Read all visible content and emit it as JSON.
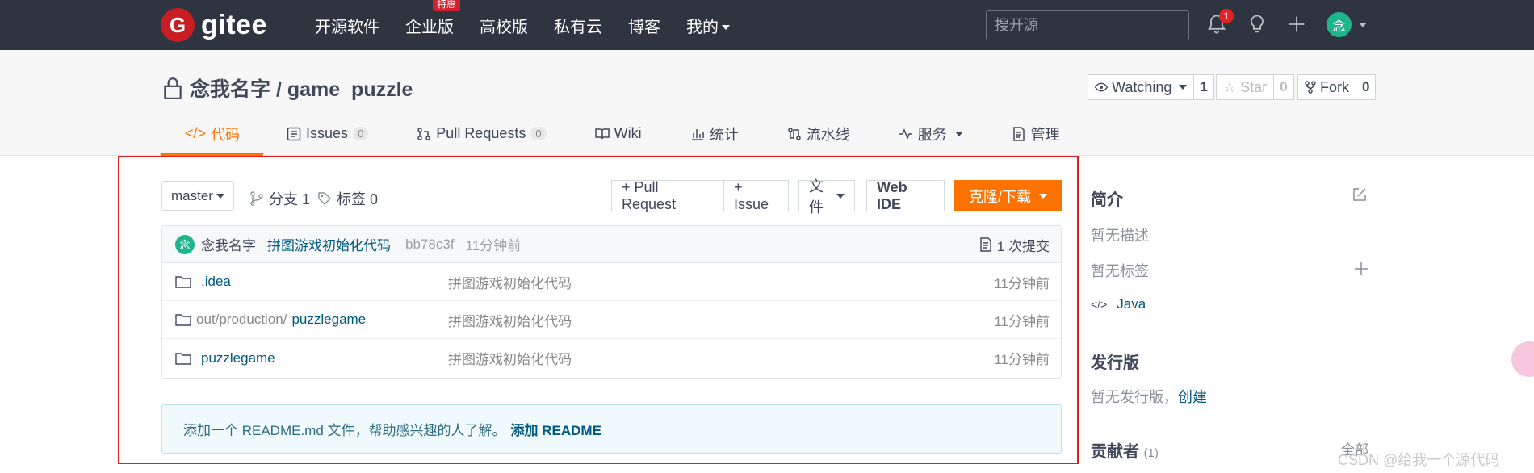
{
  "topbar": {
    "logo_mark": "G",
    "logo_text": "gitee",
    "nav": [
      {
        "label": "开源软件"
      },
      {
        "label": "企业版",
        "badge": "特惠"
      },
      {
        "label": "高校版"
      },
      {
        "label": "私有云"
      },
      {
        "label": "博客"
      },
      {
        "label": "我的"
      }
    ],
    "search_placeholder": "搜开源",
    "notification_count": "1",
    "avatar_char": "念"
  },
  "repo": {
    "title": "念我名字 / game_puzzle",
    "watching_label": "Watching",
    "watching_count": "1",
    "star_label": "Star",
    "star_count": "0",
    "fork_label": "Fork",
    "fork_count": "0",
    "tabs": [
      {
        "label": "代码",
        "active": true
      },
      {
        "label": "Issues",
        "count": "0"
      },
      {
        "label": "Pull Requests",
        "count": "0"
      },
      {
        "label": "Wiki"
      },
      {
        "label": "统计"
      },
      {
        "label": "流水线"
      },
      {
        "label": "服务"
      },
      {
        "label": "管理"
      }
    ]
  },
  "toolbar": {
    "branch": "master",
    "branches": "分支 1",
    "tags": "标签 0",
    "pull_request": "+ Pull Request",
    "issue": "+ Issue",
    "files": "文件",
    "web_ide": "Web IDE",
    "clone": "克隆/下载"
  },
  "commit": {
    "avatar_char": "念",
    "author": "念我名字",
    "message": "拼图游戏初始化代码",
    "hash": "bb78c3f",
    "time": "11分钟前",
    "count": "1 次提交"
  },
  "files": [
    {
      "prefix": "",
      "name": ".idea",
      "commit": "拼图游戏初始化代码",
      "time": "11分钟前"
    },
    {
      "prefix": "out/production/",
      "name": "puzzlegame",
      "commit": "拼图游戏初始化代码",
      "time": "11分钟前"
    },
    {
      "prefix": "",
      "name": "puzzlegame",
      "commit": "拼图游戏初始化代码",
      "time": "11分钟前"
    }
  ],
  "readme": {
    "text": "添加一个 README.md 文件，帮助感兴趣的人了解。",
    "link": "添加 README"
  },
  "sidebar": {
    "intro_title": "简介",
    "no_desc": "暂无描述",
    "no_tags": "暂无标签",
    "language": "Java",
    "release_title": "发行版",
    "no_release": "暂无发行版，",
    "create_link": "创建",
    "contributors_title": "贡献者",
    "contributors_count": "(1)",
    "all_link": "全部"
  },
  "watermark": "CSDN @给我一个源代码",
  "colors": {
    "accent": "#fe7300",
    "navbar": "#2e3540",
    "link": "#005980",
    "highlight_border": "#e02020"
  }
}
